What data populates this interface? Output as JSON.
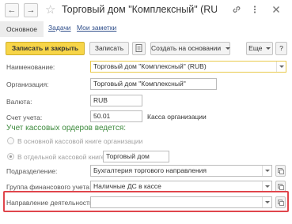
{
  "window": {
    "title": "Торговый дом \"Комплексный\" (RUB) (Ка...",
    "icons": [
      "link-icon",
      "more-icon",
      "close-icon"
    ]
  },
  "nav": {
    "back_icon": "←",
    "forward_icon": "→",
    "star_icon": "☆"
  },
  "tabs": [
    {
      "label": "Основное"
    },
    {
      "label": "Задачи"
    },
    {
      "label": "Мои заметки"
    }
  ],
  "toolbar": {
    "save_close": "Записать и закрыть",
    "save": "Записать",
    "create_based": "Создать на основании",
    "more": "Еще",
    "help": "?"
  },
  "form": {
    "name": {
      "label": "Наименование:",
      "value": "Торговый дом \"Комплексный\" (RUB)"
    },
    "organization": {
      "label": "Организация:",
      "value": "Торговый дом \"Комплексный\""
    },
    "currency": {
      "label": "Валюта:",
      "value": "RUB"
    },
    "account": {
      "label": "Счет учета:",
      "value": "50.01",
      "hint": "Касса организации"
    },
    "section_title": "Учет кассовых ордеров ведется:",
    "option_main": "В основной кассовой книге организации",
    "option_separate": "В отдельной кассовой книге",
    "separate_value": "Торговый дом",
    "division": {
      "label": "Подразделение:",
      "value": "Бухгалтерия торгового направления"
    },
    "fin_group": {
      "label": "Группа финансового учета:",
      "value": "Наличные ДС в кассе"
    },
    "direction": {
      "label": "Направление деятельности:",
      "value": ""
    }
  },
  "colors": {
    "accent": "#f7d548",
    "section": "#3c8a3c",
    "highlight": "#e0454c",
    "link": "#2f4e8a"
  }
}
